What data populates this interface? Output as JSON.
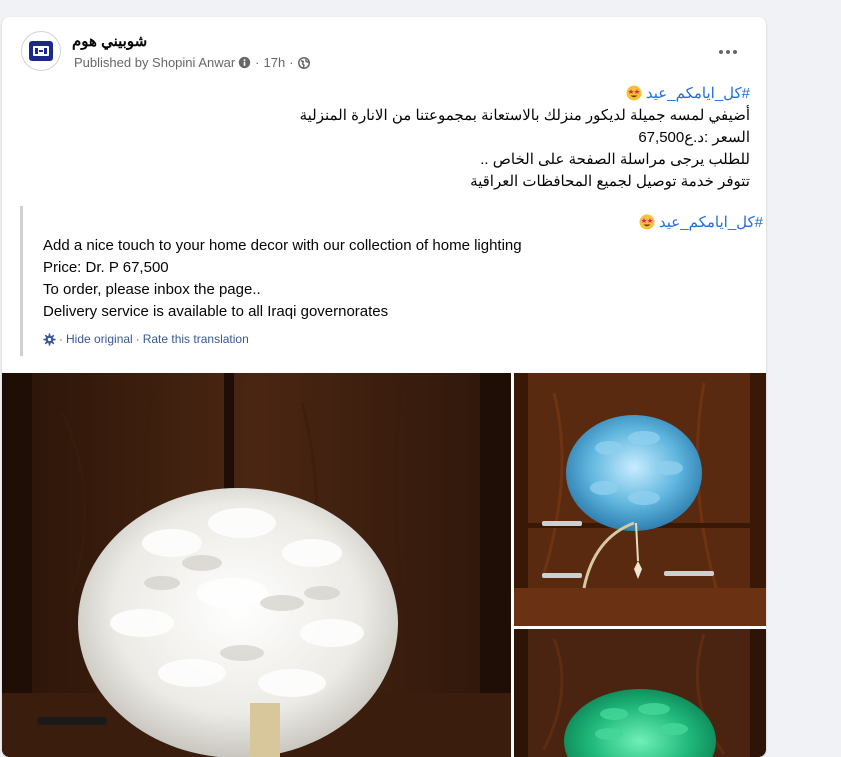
{
  "post": {
    "page_name": "شوبيني هوم",
    "published_by": "Published by Shopini Anwar",
    "time": "17h",
    "body_hashtag": "#كل_ايامكم_عيد",
    "body_lines": [
      "أضيفي لمسه جميلة لديكور منزلك بالاستعانة بمجموعتنا من الانارة المنزلية",
      "السعر :د.ع67,500",
      "للطلب يرجى مراسلة الصفحة على الخاص ..",
      "تتوفر خدمة توصيل لجميع المحافظات العراقية"
    ]
  },
  "translation": {
    "hashtag": "#كل_ايامكم_عيد",
    "lines": [
      "Add a nice touch to your home decor with our collection of home lighting",
      "Price: Dr. P 67,500",
      "To order, please inbox the page..",
      "Delivery service is available to all Iraqi governorates"
    ],
    "hide_original": "Hide original",
    "rate_translation": "Rate this translation"
  },
  "icons": {
    "avatar": "shop-logo-icon",
    "globe": "globe-icon",
    "info": "info-icon",
    "more": "more-options-icon",
    "gear": "gear-icon",
    "emoji": "star-struck-emoji-icon"
  },
  "photos": {
    "main": "white-feather-lamp-photo",
    "top_right": "blue-feather-lamp-photo",
    "bottom_right": "green-feather-lamp-photo"
  },
  "colors": {
    "link": "#216fdb",
    "translation_link": "#385898",
    "meta": "#65676b",
    "background": "#f0f2f5"
  }
}
